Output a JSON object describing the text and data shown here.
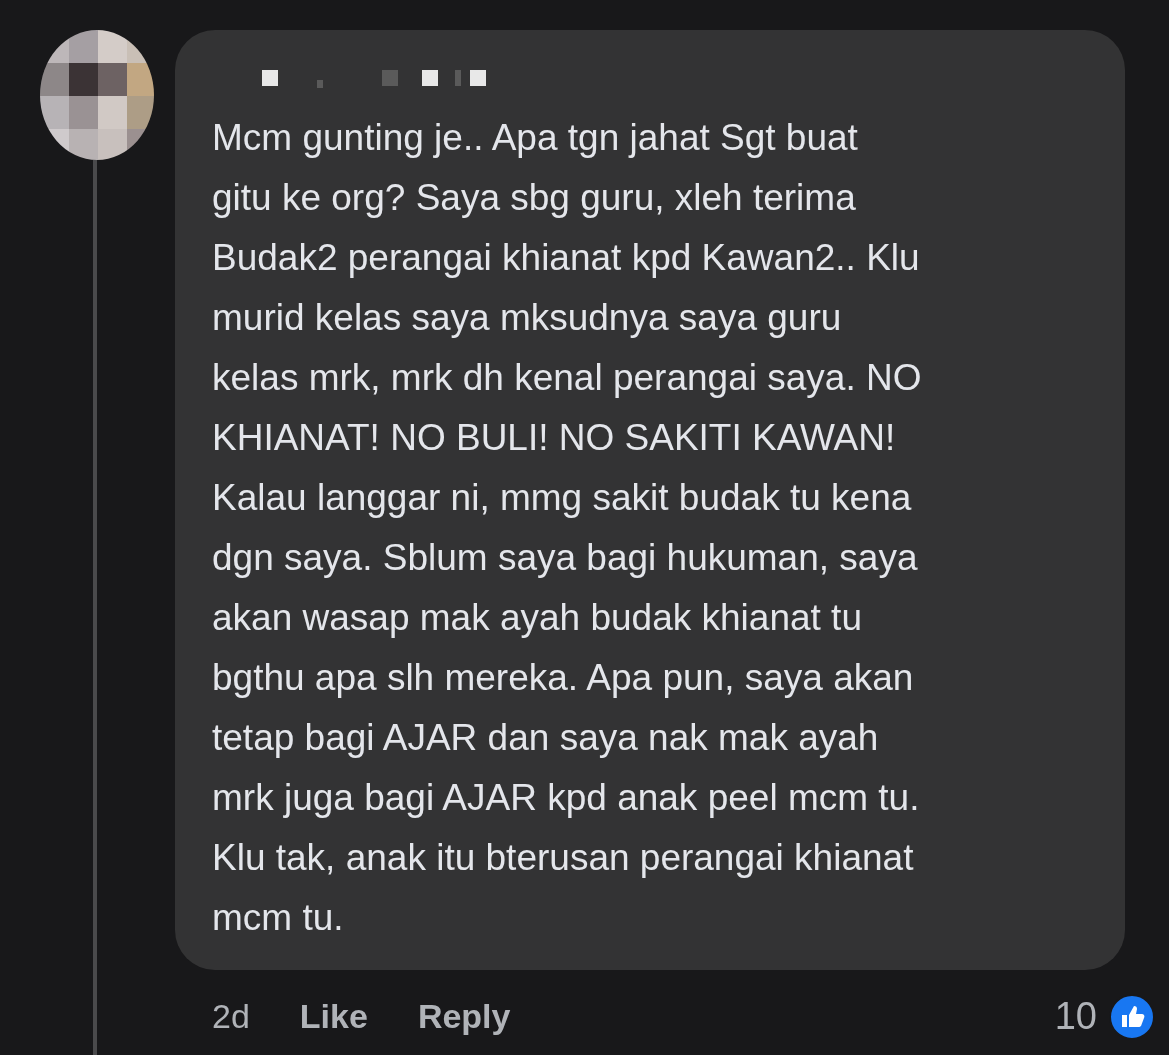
{
  "comment": {
    "text_lines": [
      "Mcm gunting je.. Apa tgn jahat Sgt buat",
      "gitu ke org? Saya sbg guru, xleh terima",
      "Budak2 perangai khianat kpd Kawan2.. Klu",
      "murid kelas saya mksudnya saya guru",
      "kelas mrk, mrk dh kenal perangai saya. NO",
      "KHIANAT! NO BULI! NO SAKITI KAWAN!",
      "Kalau langgar ni, mmg sakit budak tu kena",
      "dgn saya. Sblum saya bagi hukuman, saya",
      "akan wasap mak ayah budak khianat tu",
      "bgthu apa slh mereka. Apa pun, saya akan",
      "tetap bagi AJAR dan saya nak mak ayah",
      "mrk juga bagi AJAR kpd anak peel mcm tu.",
      "Klu tak, anak itu bterusan perangai khianat",
      "mcm tu."
    ],
    "time": "2d",
    "actions": [
      "Like",
      "Reply"
    ],
    "reaction_count": "10"
  }
}
